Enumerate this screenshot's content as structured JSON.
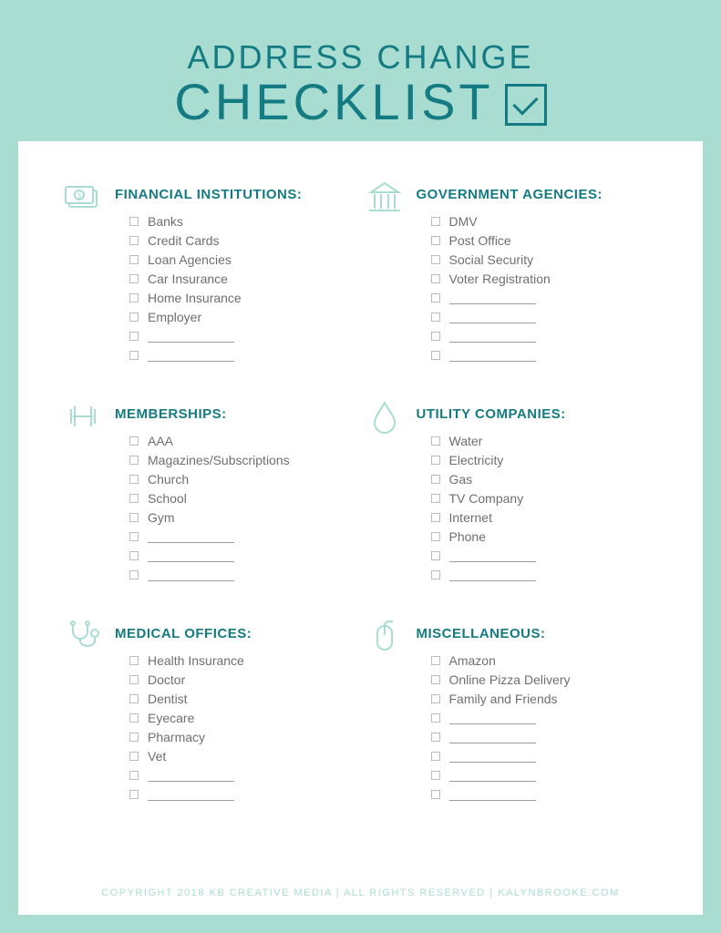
{
  "header": {
    "line1": "ADDRESS CHANGE",
    "line2": "CHECKLIST"
  },
  "sections": [
    {
      "icon": "money-icon",
      "title": "FINANCIAL INSTITUTIONS:",
      "items": [
        "Banks",
        "Credit Cards",
        "Loan Agencies",
        "Car Insurance",
        "Home Insurance",
        "Employer"
      ],
      "blanks": 2
    },
    {
      "icon": "government-icon",
      "title": "GOVERNMENT AGENCIES:",
      "items": [
        "DMV",
        "Post Office",
        "Social Security",
        "Voter Registration"
      ],
      "blanks": 4
    },
    {
      "icon": "dumbbell-icon",
      "title": "MEMBERSHIPS:",
      "items": [
        "AAA",
        "Magazines/Subscriptions",
        "Church",
        "School",
        "Gym"
      ],
      "blanks": 3
    },
    {
      "icon": "water-drop-icon",
      "title": "UTILITY COMPANIES:",
      "items": [
        "Water",
        "Electricity",
        "Gas",
        "TV Company",
        "Internet",
        "Phone"
      ],
      "blanks": 2
    },
    {
      "icon": "stethoscope-icon",
      "title": "MEDICAL OFFICES:",
      "items": [
        "Health Insurance",
        "Doctor",
        "Dentist",
        "Eyecare",
        "Pharmacy",
        "Vet"
      ],
      "blanks": 2
    },
    {
      "icon": "mouse-icon",
      "title": "MISCELLANEOUS:",
      "items": [
        "Amazon",
        "Online Pizza Delivery",
        "Family and Friends"
      ],
      "blanks": 5
    }
  ],
  "footer": "COPYRIGHT 2018 KB CREATIVE MEDIA   |   ALL RIGHTS RESERVED   |   KALYNBROOKE.COM",
  "colors": {
    "accent": "#a9ddd2",
    "heading": "#147b82",
    "text": "#6b7073"
  }
}
